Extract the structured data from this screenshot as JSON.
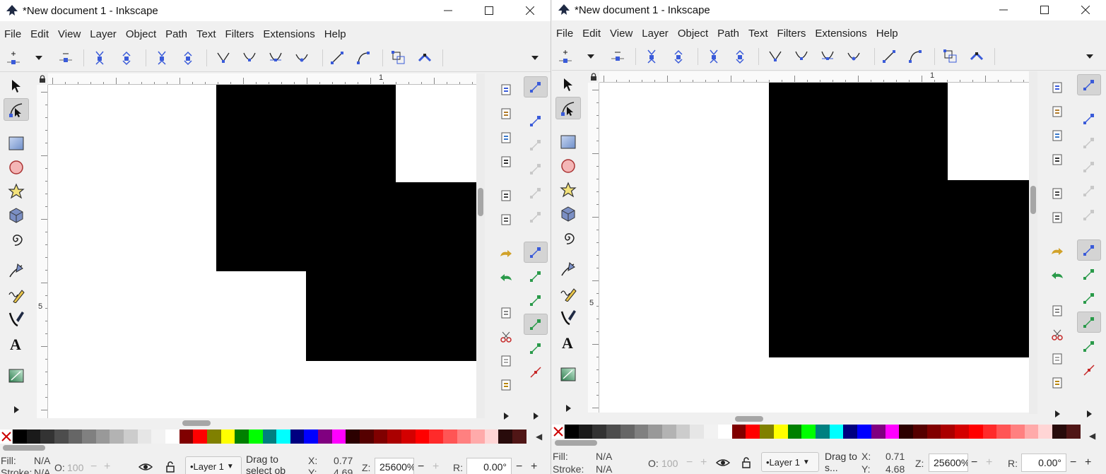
{
  "left_window": {
    "title": "*New document 1 - Inkscape",
    "menu": [
      "File",
      "Edit",
      "View",
      "Layer",
      "Object",
      "Path",
      "Text",
      "Filters",
      "Extensions",
      "Help"
    ],
    "ruler": {
      "top_label": "1",
      "left_label": "5"
    },
    "status": {
      "fill_label": "Fill:",
      "fill_value": "N/A",
      "stroke_label": "Stroke:",
      "stroke_value": "N/A",
      "opacity_label": "O:",
      "opacity_value": "100",
      "layer": "•Layer 1",
      "message": "Drag to select ob",
      "x_label": "X:",
      "x_value": "0.77",
      "y_label": "Y:",
      "y_value": "4.69",
      "zoom_label": "Z:",
      "zoom_value": "25600%",
      "rotation_label": "R:",
      "rotation_value": "0.00°"
    }
  },
  "right_window": {
    "title": "*New document 1 - Inkscape",
    "menu": [
      "File",
      "Edit",
      "View",
      "Layer",
      "Object",
      "Path",
      "Text",
      "Filters",
      "Extensions",
      "Help"
    ],
    "ruler": {
      "top_label": "1",
      "left_label": "5"
    },
    "status": {
      "fill_label": "Fill:",
      "fill_value": "N/A",
      "stroke_label": "Stroke:",
      "stroke_value": "N/A",
      "opacity_label": "O:",
      "opacity_value": "100",
      "layer": "•Layer 1",
      "message": "Drag to s...",
      "x_label": "X:",
      "x_value": "0.71",
      "y_label": "Y:",
      "y_value": "4.68",
      "zoom_label": "Z:",
      "zoom_value": "25600%",
      "rotation_label": "R:",
      "rotation_value": "0.00°"
    }
  },
  "colors": {
    "accent": "#3a5bd9",
    "palette_left": [
      "#000000",
      "#1a1a1a",
      "#333333",
      "#4d4d4d",
      "#666666",
      "#808080",
      "#999999",
      "#b3b3b3",
      "#cccccc",
      "#e6e6e6",
      "#f2f2f2",
      "#ffffff",
      "#800000",
      "#ff0000",
      "#808000",
      "#ffff00",
      "#008000",
      "#00ff00",
      "#008080",
      "#00ffff",
      "#000080",
      "#0000ff",
      "#800080",
      "#ff00ff",
      "#2b0000",
      "#550000",
      "#800000",
      "#aa0000",
      "#d40000",
      "#ff0000",
      "#ff2a2a",
      "#ff5555",
      "#ff8080",
      "#ffaaaa",
      "#ffd5d5",
      "#280b0b",
      "#501616"
    ],
    "palette_right": [
      "#000000",
      "#1a1a1a",
      "#333333",
      "#4d4d4d",
      "#666666",
      "#808080",
      "#999999",
      "#b3b3b3",
      "#cccccc",
      "#e6e6e6",
      "#f2f2f2",
      "#ffffff",
      "#800000",
      "#ff0000",
      "#808000",
      "#ffff00",
      "#008000",
      "#00ff00",
      "#008080",
      "#00ffff",
      "#000080",
      "#0000ff",
      "#800080",
      "#ff00ff",
      "#2b0000",
      "#550000",
      "#800000",
      "#aa0000",
      "#d40000",
      "#ff0000",
      "#ff2a2a",
      "#ff5555",
      "#ff8080",
      "#ffaaaa",
      "#ffd5d5",
      "#280b0b",
      "#501616"
    ]
  },
  "icons": {
    "tools": [
      "selector-icon",
      "node-editor-icon",
      "rectangle-icon",
      "ellipse-icon",
      "star-icon",
      "box3d-icon",
      "spiral-icon",
      "pen-icon",
      "pencil-icon",
      "calligraphy-icon",
      "text-icon",
      "gradient-icon"
    ],
    "commands": [
      "insert-node-icon",
      "node-dropdown-icon",
      "delete-node-icon",
      "join-nodes-icon",
      "break-path-icon",
      "join-segment-icon",
      "delete-segment-icon",
      "node-cusp-icon",
      "node-smooth-icon",
      "node-symmetric-icon",
      "node-auto-icon",
      "segment-line-icon",
      "segment-curve-icon",
      "object-to-path-icon",
      "stroke-to-path-icon"
    ]
  }
}
